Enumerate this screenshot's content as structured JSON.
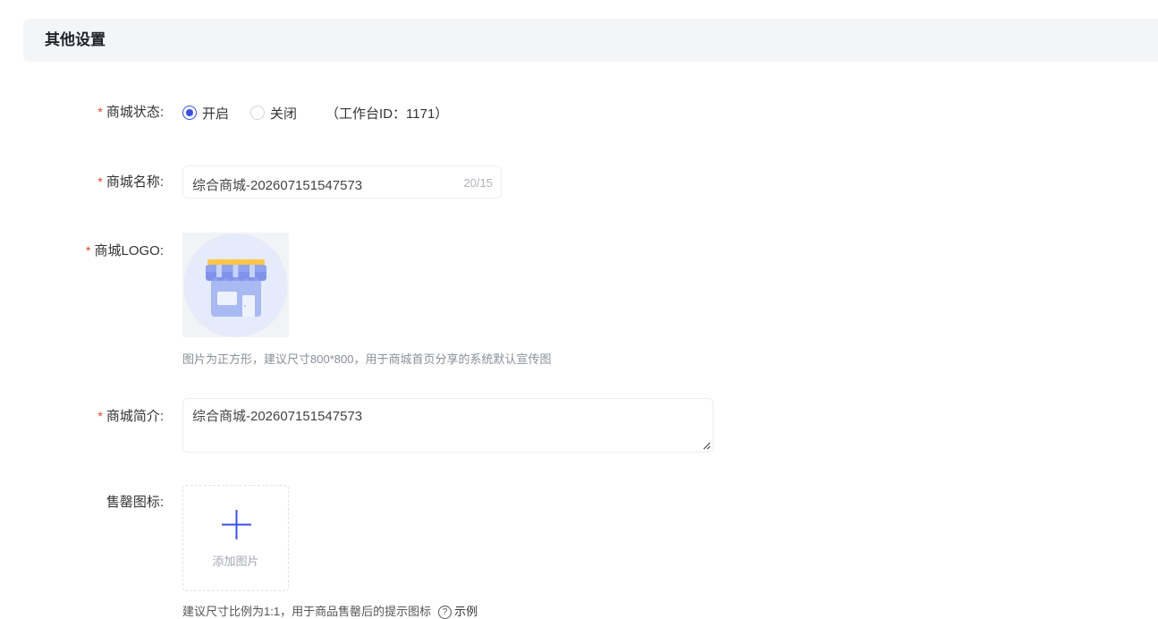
{
  "section": {
    "title": "其他设置"
  },
  "required_mark": "*",
  "status": {
    "label": "商城状态:",
    "options": [
      {
        "label": "开启",
        "selected": true
      },
      {
        "label": "关闭",
        "selected": false
      }
    ],
    "workspace_note": "（工作台ID：1171）"
  },
  "name": {
    "label": "商城名称:",
    "value": "综合商城-202607151547573",
    "counter": "20/15"
  },
  "logo": {
    "label": "商城LOGO:",
    "icon": "storefront-logo-icon",
    "hint": "图片为正方形，建议尺寸800*800，用于商城首页分享的系统默认宣传图"
  },
  "intro": {
    "label": "商城简介:",
    "value": "综合商城-202607151547573"
  },
  "soldout_icon": {
    "label": "售罄图标:",
    "upload_label": "添加图片",
    "hint": "建议尺寸比例为1:1，用于商品售罄后的提示图标",
    "example_label": "示例"
  },
  "colors": {
    "accent": "#3b50e0",
    "required": "#e0442b",
    "header_bg": "#f4f5f7"
  }
}
